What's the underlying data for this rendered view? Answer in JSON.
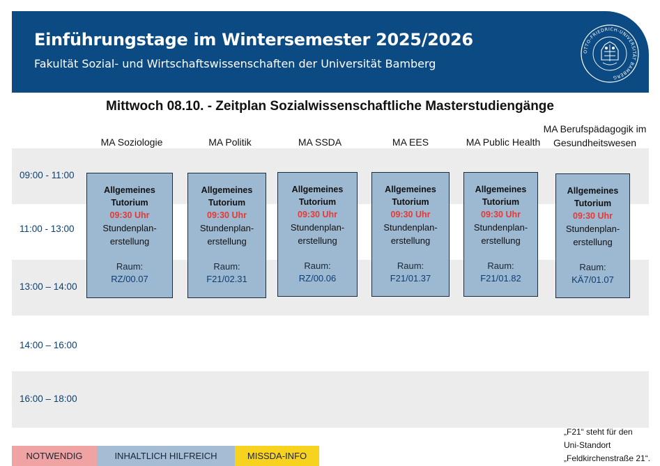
{
  "header": {
    "title": "Einführungstage im Wintersemester 2025/2026",
    "subtitle": "Fakultät Sozial- und Wirtschaftswissenschaften der Universität Bamberg",
    "logo_text": "OTTO-FRIEDRICH-UNIVERSITÄT BAMBERG"
  },
  "day_title": "Mittwoch 08.10. - Zeitplan Sozialwissenschaftliche Masterstudiengänge",
  "columns": [
    {
      "label": "MA  Soziologie"
    },
    {
      "label": "MA Politik"
    },
    {
      "label": "MA SSDA"
    },
    {
      "label": "MA EES"
    },
    {
      "label": "MA Public Health"
    },
    {
      "label_line1": "MA Berufspädagogik im",
      "label_line2": "Gesundheitswesen"
    }
  ],
  "time_slots": [
    "09:00 - 11:00",
    "11:00 - 13:00",
    "13:00 – 14:00",
    "14:00 – 16:00",
    "16:00 – 18:00"
  ],
  "events": [
    {
      "title_line1": "Allgemeines",
      "title_line2": "Tutorium",
      "time": "09:30 Uhr",
      "desc_line1": "Stundenplan-",
      "desc_line2": "erstellung",
      "room_label": "Raum:",
      "room": "RZ/00.07"
    },
    {
      "title_line1": "Allgemeines",
      "title_line2": "Tutorium",
      "time": "09:30 Uhr",
      "desc_line1": "Stundenplan-",
      "desc_line2": "erstellung",
      "room_label": "Raum:",
      "room": "F21/02.31"
    },
    {
      "title_line1": "Allgemeines",
      "title_line2": "Tutorium",
      "time": "09:30 Uhr",
      "desc_line1": "Stundenplan-",
      "desc_line2": "erstellung",
      "room_label": "Raum:",
      "room": "RZ/00.06"
    },
    {
      "title_line1": "Allgemeines",
      "title_line2": "Tutorium",
      "time": "09:30 Uhr",
      "desc_line1": "Stundenplan-",
      "desc_line2": "erstellung",
      "room_label": "Raum:",
      "room": "F21/01.37"
    },
    {
      "title_line1": "Allgemeines",
      "title_line2": "Tutorium",
      "time": "09:30 Uhr",
      "desc_line1": "Stundenplan-",
      "desc_line2": "erstellung",
      "room_label": "Raum:",
      "room": "F21/01.82"
    },
    {
      "title_line1": "Allgemeines",
      "title_line2": "Tutorium",
      "time": "09:30 Uhr",
      "desc_line1": "Stundenplan-",
      "desc_line2": "erstellung",
      "room_label": "Raum:",
      "room": "KÄ7/01.07"
    }
  ],
  "legend": [
    {
      "label": "NOTWENDIG",
      "color": "#f0a3a3"
    },
    {
      "label": "INHALTLICH HILFREICH",
      "color": "#a4bdd5"
    },
    {
      "label": "MISSDA-INFO",
      "color": "#f7d21e"
    }
  ],
  "note": {
    "line1": "„F21“ steht für den",
    "line2": "Uni-Standort",
    "line3": "„Feldkirchenstraße 21“."
  },
  "colors": {
    "header_bg": "#0b4a82",
    "event_bg": "#9db8d1",
    "highlight_time": "#e53935",
    "stripe": "#ececec"
  }
}
